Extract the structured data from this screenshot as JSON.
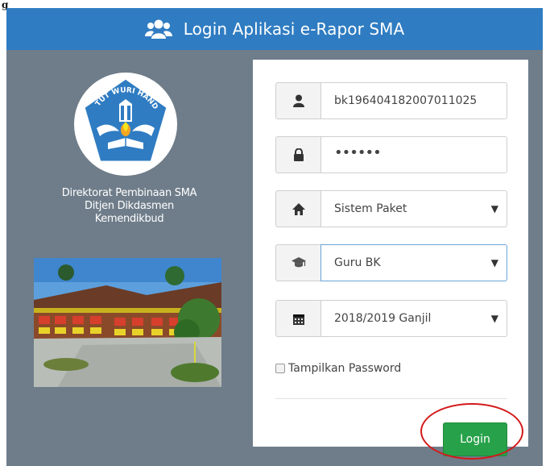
{
  "caption": "g",
  "header": {
    "title": "Login Aplikasi e-Rapor SMA",
    "icon": "users-icon"
  },
  "org": {
    "line1": "Direktorat Pembinaan SMA",
    "line2": "Ditjen Dikdasmen",
    "line3": "Kemendikbud",
    "logo_text": "TUT WURI HANDAYANI"
  },
  "form": {
    "username": {
      "icon": "user-icon",
      "value": "bk196404182007011025"
    },
    "password": {
      "icon": "lock-icon",
      "value": "••••••"
    },
    "curriculum": {
      "icon": "home-icon",
      "value": "Sistem Paket"
    },
    "role": {
      "icon": "graduation-cap-icon",
      "value": "Guru BK"
    },
    "semester": {
      "icon": "calendar-icon",
      "value": "2018/2019 Ganjil"
    },
    "show_password_label": "Tampilkan Password",
    "login_label": "Login"
  },
  "colors": {
    "header": "#2f7cc2",
    "panel": "#6f7d8a",
    "login": "#28a24a",
    "highlight": "#d4191a"
  }
}
